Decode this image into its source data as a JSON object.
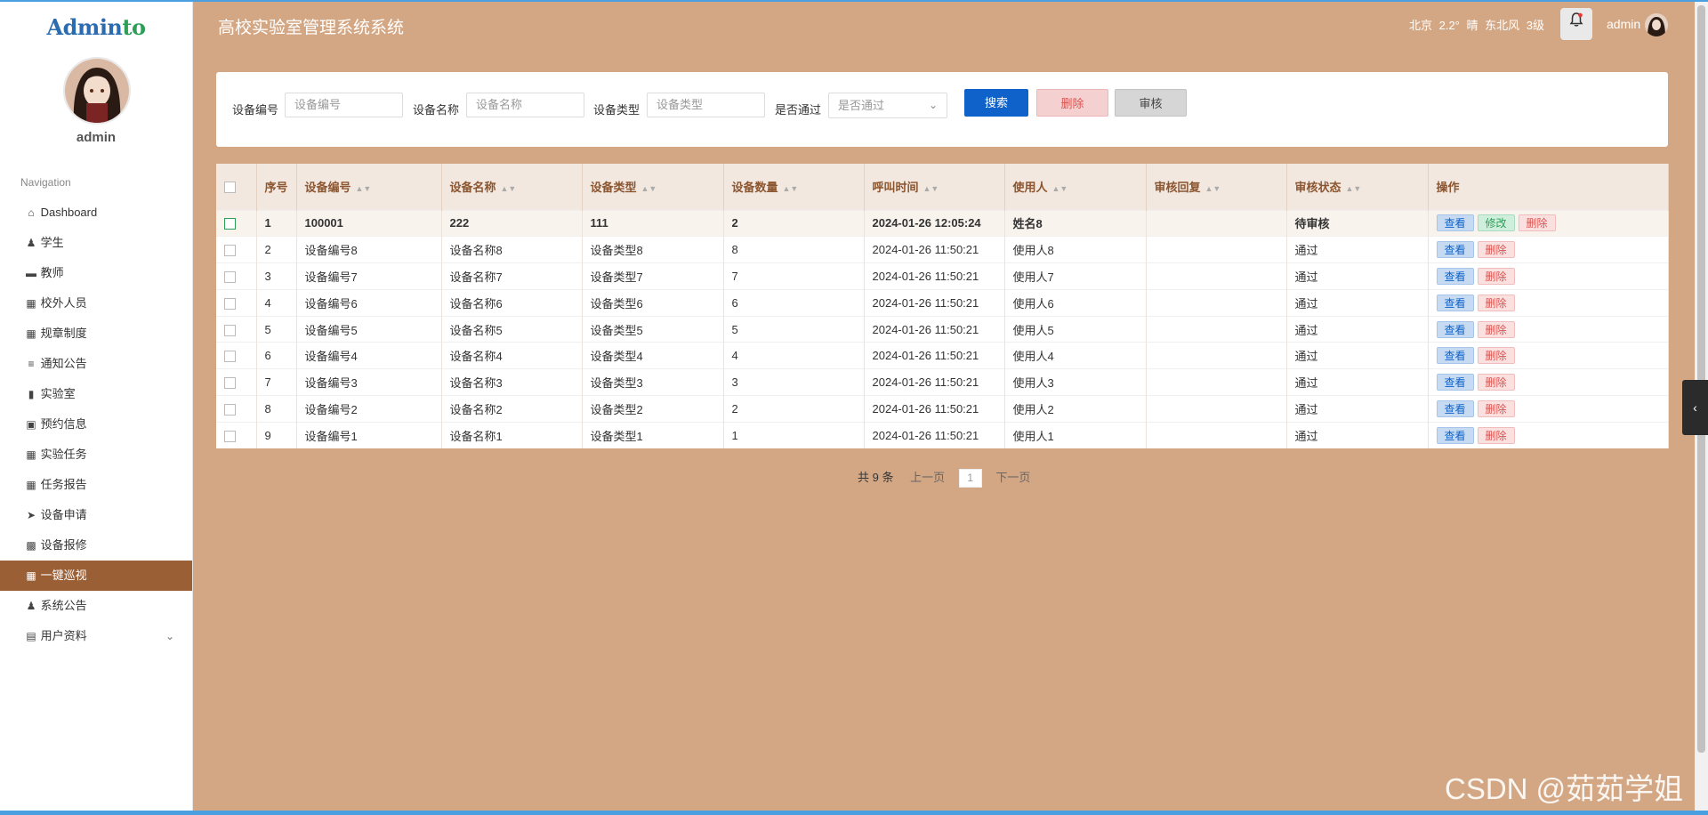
{
  "app": {
    "title": "高校实验室管理系统系统"
  },
  "logo": {
    "part1": "Admin",
    "part2": "to"
  },
  "sidebar": {
    "username": "admin",
    "nav_title": "Navigation",
    "items": [
      {
        "label": "Dashboard",
        "icon": "home-icon"
      },
      {
        "label": "学生",
        "icon": "user-icon"
      },
      {
        "label": "教师",
        "icon": "monitor-icon"
      },
      {
        "label": "校外人员",
        "icon": "grid-icon"
      },
      {
        "label": "规章制度",
        "icon": "grid-icon"
      },
      {
        "label": "通知公告",
        "icon": "list-icon"
      },
      {
        "label": "实验室",
        "icon": "library-icon"
      },
      {
        "label": "预约信息",
        "icon": "clipboard-icon"
      },
      {
        "label": "实验任务",
        "icon": "grid-icon"
      },
      {
        "label": "任务报告",
        "icon": "grid-icon"
      },
      {
        "label": "设备申请",
        "icon": "send-icon"
      },
      {
        "label": "设备报修",
        "icon": "grid-small-icon"
      },
      {
        "label": "一键巡视",
        "icon": "grid-icon",
        "active": true
      },
      {
        "label": "系统公告",
        "icon": "user-icon"
      },
      {
        "label": "用户资料",
        "icon": "card-icon",
        "has_submenu": true
      }
    ]
  },
  "header": {
    "weather": "北京 2.2° 晴 东北风 3级",
    "username": "admin"
  },
  "search": {
    "fields": [
      {
        "label": "设备编号",
        "placeholder": "设备编号"
      },
      {
        "label": "设备名称",
        "placeholder": "设备名称"
      },
      {
        "label": "设备类型",
        "placeholder": "设备类型"
      }
    ],
    "select": {
      "label": "是否通过",
      "value": "是否通过"
    },
    "buttons": {
      "search": "搜索",
      "delete": "删除",
      "audit": "审核"
    }
  },
  "table": {
    "headers": [
      "序号",
      "设备编号",
      "设备名称",
      "设备类型",
      "设备数量",
      "呼叫时间",
      "使用人",
      "审核回复",
      "审核状态",
      "操作"
    ],
    "rows": [
      {
        "idx": "1",
        "code": "100001",
        "name": "222",
        "type": "111",
        "qty": "2",
        "time": "2024-01-26 12:05:24",
        "user": "姓名8",
        "reply": "",
        "status": "待审核",
        "actions": [
          "查看",
          "修改",
          "删除"
        ]
      },
      {
        "idx": "2",
        "code": "设备编号8",
        "name": "设备名称8",
        "type": "设备类型8",
        "qty": "8",
        "time": "2024-01-26 11:50:21",
        "user": "使用人8",
        "reply": "",
        "status": "通过",
        "actions": [
          "查看",
          "删除"
        ]
      },
      {
        "idx": "3",
        "code": "设备编号7",
        "name": "设备名称7",
        "type": "设备类型7",
        "qty": "7",
        "time": "2024-01-26 11:50:21",
        "user": "使用人7",
        "reply": "",
        "status": "通过",
        "actions": [
          "查看",
          "删除"
        ]
      },
      {
        "idx": "4",
        "code": "设备编号6",
        "name": "设备名称6",
        "type": "设备类型6",
        "qty": "6",
        "time": "2024-01-26 11:50:21",
        "user": "使用人6",
        "reply": "",
        "status": "通过",
        "actions": [
          "查看",
          "删除"
        ]
      },
      {
        "idx": "5",
        "code": "设备编号5",
        "name": "设备名称5",
        "type": "设备类型5",
        "qty": "5",
        "time": "2024-01-26 11:50:21",
        "user": "使用人5",
        "reply": "",
        "status": "通过",
        "actions": [
          "查看",
          "删除"
        ]
      },
      {
        "idx": "6",
        "code": "设备编号4",
        "name": "设备名称4",
        "type": "设备类型4",
        "qty": "4",
        "time": "2024-01-26 11:50:21",
        "user": "使用人4",
        "reply": "",
        "status": "通过",
        "actions": [
          "查看",
          "删除"
        ]
      },
      {
        "idx": "7",
        "code": "设备编号3",
        "name": "设备名称3",
        "type": "设备类型3",
        "qty": "3",
        "time": "2024-01-26 11:50:21",
        "user": "使用人3",
        "reply": "",
        "status": "通过",
        "actions": [
          "查看",
          "删除"
        ]
      },
      {
        "idx": "8",
        "code": "设备编号2",
        "name": "设备名称2",
        "type": "设备类型2",
        "qty": "2",
        "time": "2024-01-26 11:50:21",
        "user": "使用人2",
        "reply": "",
        "status": "通过",
        "actions": [
          "查看",
          "删除"
        ]
      },
      {
        "idx": "9",
        "code": "设备编号1",
        "name": "设备名称1",
        "type": "设备类型1",
        "qty": "1",
        "time": "2024-01-26 11:50:21",
        "user": "使用人1",
        "reply": "",
        "status": "通过",
        "actions": [
          "查看",
          "删除"
        ]
      }
    ]
  },
  "pager": {
    "total": "共 9 条",
    "prev": "上一页",
    "current": "1",
    "next": "下一页"
  },
  "watermark": "CSDN @茹茹学姐",
  "colors": {
    "background": "#d4a784",
    "accent": "#9a5f35",
    "primary": "#0f62c9",
    "danger": "#d9534f",
    "success": "#2f9e58"
  }
}
